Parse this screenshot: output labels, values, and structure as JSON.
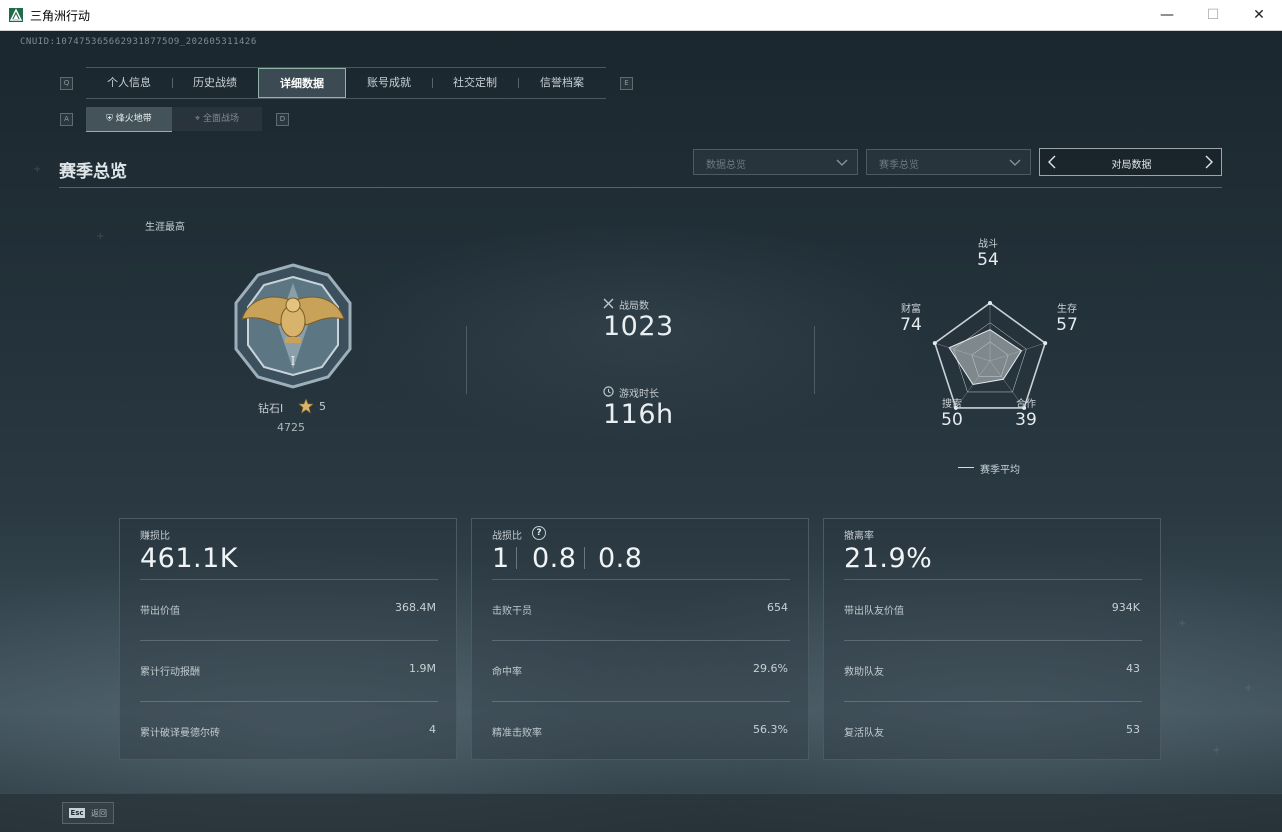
{
  "window": {
    "title": "三角洲行动",
    "minimize": "—",
    "maximize": "☐",
    "close": "✕"
  },
  "cnuid": "CNUID:1074753656629318775O9_202605311426",
  "keys": {
    "prev_tab": "Q",
    "next_tab": "E",
    "prev_sub": "A",
    "next_sub": "D"
  },
  "tabs": [
    {
      "label": "个人信息",
      "active": false
    },
    {
      "label": "历史战绩",
      "active": false
    },
    {
      "label": "详细数据",
      "active": true
    },
    {
      "label": "账号成就",
      "active": false
    },
    {
      "label": "社交定制",
      "active": false
    },
    {
      "label": "信誉档案",
      "active": false
    }
  ],
  "subtabs": [
    {
      "label": "烽火地带",
      "active": true,
      "icon": "stronghold-icon"
    },
    {
      "label": "全面战场",
      "active": false,
      "icon": "crosshair-icon"
    }
  ],
  "section": {
    "title": "赛季总览"
  },
  "filters": {
    "data_overview": "数据总览",
    "season_overview": "赛季总览",
    "pager_label": "对局数据"
  },
  "career": {
    "label": "生涯最高",
    "rank": "钻石I",
    "stars": "5",
    "score": "4725"
  },
  "summary": {
    "matches_label": "战局数",
    "matches_value": "1023",
    "playtime_label": "游戏时长",
    "playtime_value": "116h"
  },
  "radar": {
    "axes": [
      {
        "name": "战斗",
        "value": "54"
      },
      {
        "name": "生存",
        "value": "57"
      },
      {
        "name": "合作",
        "value": "39"
      },
      {
        "name": "搜索",
        "value": "50"
      },
      {
        "name": "财富",
        "value": "74"
      }
    ],
    "levels": [
      54,
      57,
      39,
      50,
      74
    ],
    "legend": "赛季平均"
  },
  "cards": [
    {
      "header": "赚损比",
      "big": "461.1K",
      "rows": [
        {
          "label": "带出价值",
          "value": "368.4M"
        },
        {
          "label": "累计行动报酬",
          "value": "1.9M"
        },
        {
          "label": "累计破译曼德尔砖",
          "value": "4"
        }
      ]
    },
    {
      "header": "战损比",
      "big_parts": [
        "1",
        "0.8",
        "0.8"
      ],
      "help": "?",
      "rows": [
        {
          "label": "击败干员",
          "value": "654"
        },
        {
          "label": "命中率",
          "value": "29.6%"
        },
        {
          "label": "精准击败率",
          "value": "56.3%"
        }
      ]
    },
    {
      "header": "撤离率",
      "big": "21.9%",
      "rows": [
        {
          "label": "带出队友价值",
          "value": "934K"
        },
        {
          "label": "救助队友",
          "value": "43"
        },
        {
          "label": "复活队友",
          "value": "53"
        }
      ]
    }
  ],
  "footer": {
    "esc_key": "Esc",
    "esc_label": "返回"
  },
  "colors": {
    "accent": "#8fb3a8",
    "background": "#1e2a31",
    "text": "#d6dde2"
  }
}
